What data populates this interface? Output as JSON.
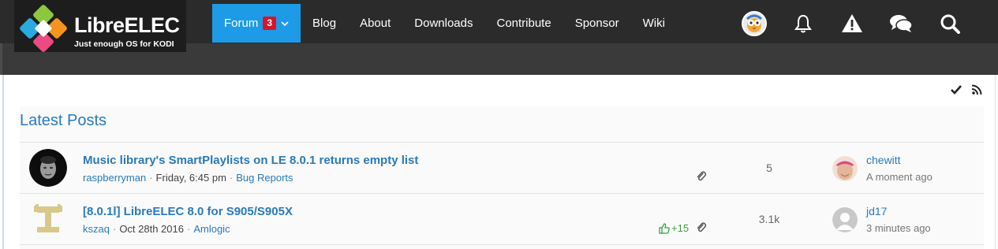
{
  "logo": {
    "title": "LibreELEC",
    "tagline": "Just enough OS for KODI"
  },
  "nav": {
    "forum_label": "Forum",
    "forum_badge": "3",
    "items": [
      "Blog",
      "About",
      "Downloads",
      "Contribute",
      "Sponsor",
      "Wiki"
    ]
  },
  "header_icons": [
    "user-avatar",
    "bell-icon",
    "warning-icon",
    "chat-icon",
    "search-icon"
  ],
  "section": {
    "title": "Latest Posts"
  },
  "posts": [
    {
      "title": "Music library's SmartPlaylists on LE 8.0.1 returns empty list",
      "author": "raspberryman",
      "date": "Friday, 6:45 pm",
      "board": "Bug Reports",
      "likes": "",
      "replies": "5",
      "last_user": "chewitt",
      "last_time": "A moment ago"
    },
    {
      "title": "[8.0.1l] LibreELEC 8.0 for S905/S905X",
      "author": "kszaq",
      "date": "Oct 28th 2016",
      "board": "Amlogic",
      "likes": "+15",
      "replies": "3.1k",
      "last_user": "jd17",
      "last_time": "3 minutes ago"
    }
  ],
  "colors": {
    "accent": "#1e9be6",
    "link": "#2a7ab8",
    "badge": "#d9142a",
    "like": "#3aa13c",
    "header": "#2b2b2b"
  }
}
